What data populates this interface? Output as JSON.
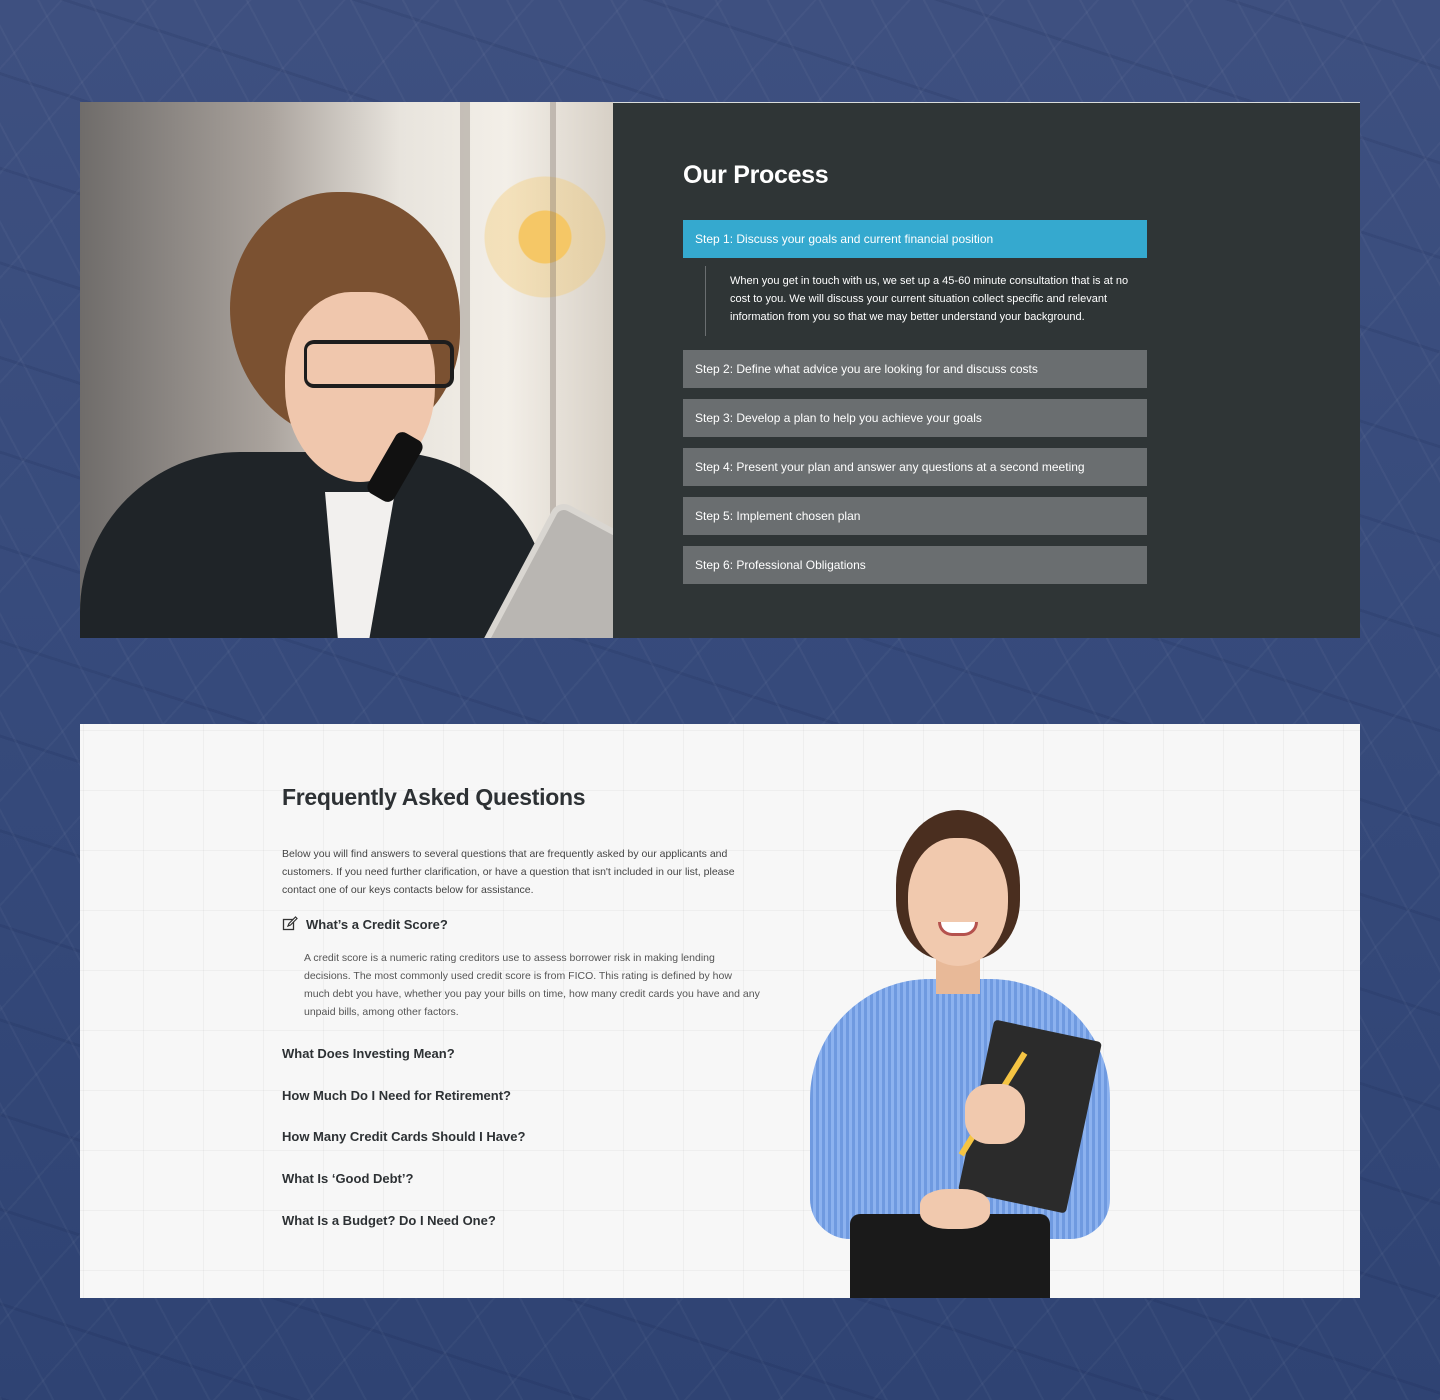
{
  "process": {
    "title": "Our Process",
    "steps": [
      {
        "label": "Step 1: Discuss your goals and current financial position",
        "active": true
      },
      {
        "label": "Step 2: Define what advice you are looking for and discuss costs",
        "active": false
      },
      {
        "label": "Step 3: Develop a plan to help you achieve your goals",
        "active": false
      },
      {
        "label": "Step 4: Present your plan and answer any questions at a second meeting",
        "active": false
      },
      {
        "label": "Step 5: Implement chosen plan",
        "active": false
      },
      {
        "label": "Step 6: Professional Obligations",
        "active": false
      }
    ],
    "active_step_body": "When you get in touch with us, we set up a 45-60 minute consultation that is at no cost to you. We will discuss your current situation collect specific and relevant information from you so that we may better understand your background."
  },
  "faq": {
    "title": "Frequently Asked Questions",
    "intro": "Below you will find answers to several questions that are frequently asked by our applicants and customers. If you need further clarification, or have a question that isn't included in our list, please contact one of our keys contacts below for assistance.",
    "open_question": {
      "icon": "edit-icon",
      "question": "What’s a Credit Score?",
      "answer": "A credit score is a numeric rating creditors use to assess borrower risk in making lending decisions. The most commonly used credit score is from FICO. This rating is defined by how much debt you have, whether you pay your bills on time, how many credit cards you have and any unpaid bills, among other factors."
    },
    "questions": [
      "What Does Investing Mean?",
      "How Much Do I Need for Retirement?",
      "How Many Credit Cards Should I Have?",
      "What Is ‘Good Debt’?",
      "What Is a Budget? Do I Need One?"
    ]
  },
  "colors": {
    "page_background": "#3c4f7f",
    "process_panel": "#2f3536",
    "step_active": "#35a9cf",
    "step_inactive": "#6a6e70",
    "faq_background": "#f7f7f7"
  }
}
